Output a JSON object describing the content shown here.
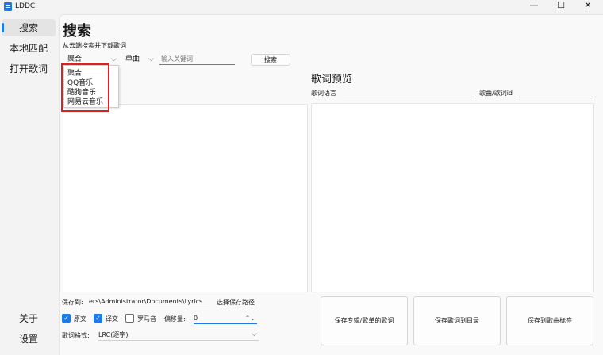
{
  "window": {
    "title": "LDDC",
    "minimize": "—",
    "maximize": "☐",
    "close": "✕"
  },
  "sidebar": {
    "items": [
      {
        "label": "搜索"
      },
      {
        "label": "本地匹配"
      },
      {
        "label": "打开歌词"
      }
    ],
    "bottom": [
      {
        "label": "关于"
      },
      {
        "label": "设置"
      }
    ]
  },
  "search": {
    "title": "搜索",
    "subtitle": "从云端搜索并下载歌词",
    "source_value": "聚合",
    "type_value": "单曲",
    "keyword_placeholder": "输入关键词",
    "search_button": "搜索",
    "source_options": [
      "聚合",
      "QQ音乐",
      "酷狗音乐",
      "网易云音乐"
    ]
  },
  "preview": {
    "title": "歌词预览",
    "lang_label": "歌词语言",
    "lang_value": "",
    "id_label": "歌曲/歌词id",
    "id_value": ""
  },
  "bottom": {
    "save_label": "保存到:",
    "save_path": "ers\\Administrator\\Documents\\Lyrics",
    "choose_path": "选择保存路径",
    "opt_original": "原文",
    "opt_translation": "译文",
    "opt_romaji": "罗马音",
    "offset_label": "偏移量:",
    "offset_value": "0",
    "format_label": "歌词格式:",
    "format_value": "LRC(逐字)",
    "btn_save_album": "保存专辑/歌单的歌词",
    "btn_save_dir": "保存歌词到目录",
    "btn_save_tag": "保存到歌曲标签"
  }
}
